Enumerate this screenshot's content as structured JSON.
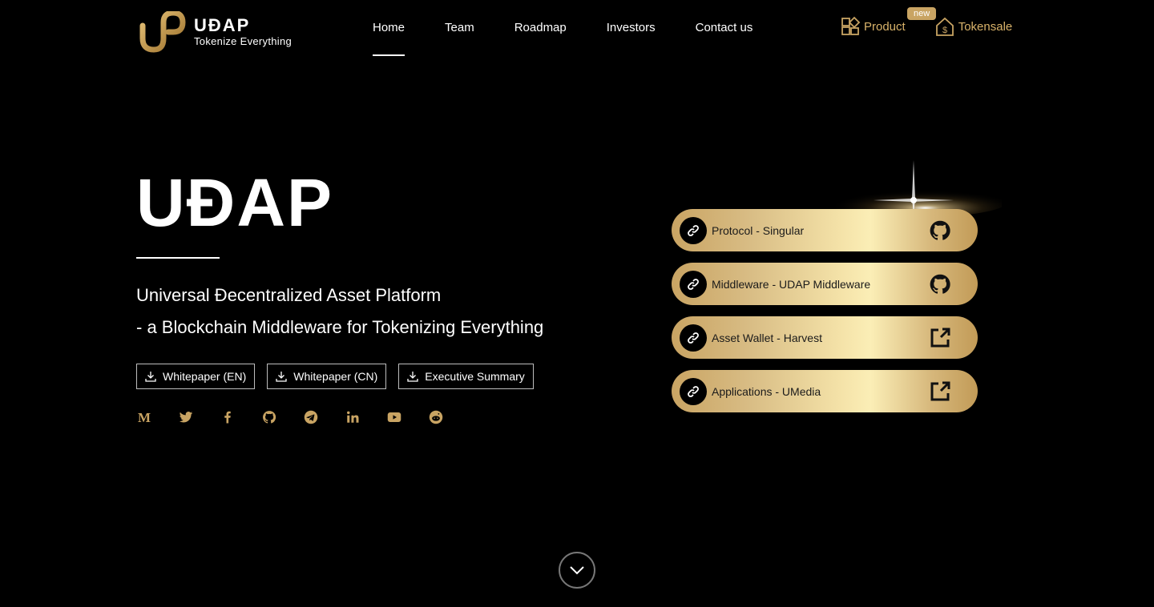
{
  "brand": {
    "name": "UĐAP",
    "tagline": "Tokenize Everything",
    "accent_color": "#c9a463"
  },
  "nav": {
    "items": [
      {
        "label": "Home",
        "active": true
      },
      {
        "label": "Team",
        "active": false
      },
      {
        "label": "Roadmap",
        "active": false
      },
      {
        "label": "Investors",
        "active": false
      },
      {
        "label": "Contact us",
        "active": false
      }
    ]
  },
  "top_right": {
    "product_label": "Product",
    "product_icon": "product-cube-icon",
    "new_badge": "new",
    "tokensale_label": "Tokensale",
    "tokensale_icon": "dollar-house-icon"
  },
  "hero": {
    "title": "UĐAP",
    "subtitle_line1": "Universal Đecentralized Asset Platform",
    "subtitle_line2": "- a Blockchain Middleware for Tokenizing Everything"
  },
  "documents": [
    {
      "label": "Whitepaper (EN)",
      "icon": "download-icon"
    },
    {
      "label": "Whitepaper (CN)",
      "icon": "download-icon"
    },
    {
      "label": "Executive Summary",
      "icon": "download-icon"
    }
  ],
  "socials": [
    "medium-icon",
    "twitter-icon",
    "facebook-icon",
    "github-icon",
    "telegram-icon",
    "linkedin-icon",
    "youtube-icon",
    "reddit-icon"
  ],
  "resource_links": [
    {
      "label": "Protocol - Singular",
      "action_icon": "github-icon"
    },
    {
      "label": "Middleware - UDAP Middleware",
      "action_icon": "github-icon"
    },
    {
      "label": "Asset Wallet - Harvest",
      "action_icon": "external-link-icon"
    },
    {
      "label": "Applications - UMedia",
      "action_icon": "external-link-icon"
    }
  ],
  "scroll_icon": "chevron-down-icon"
}
